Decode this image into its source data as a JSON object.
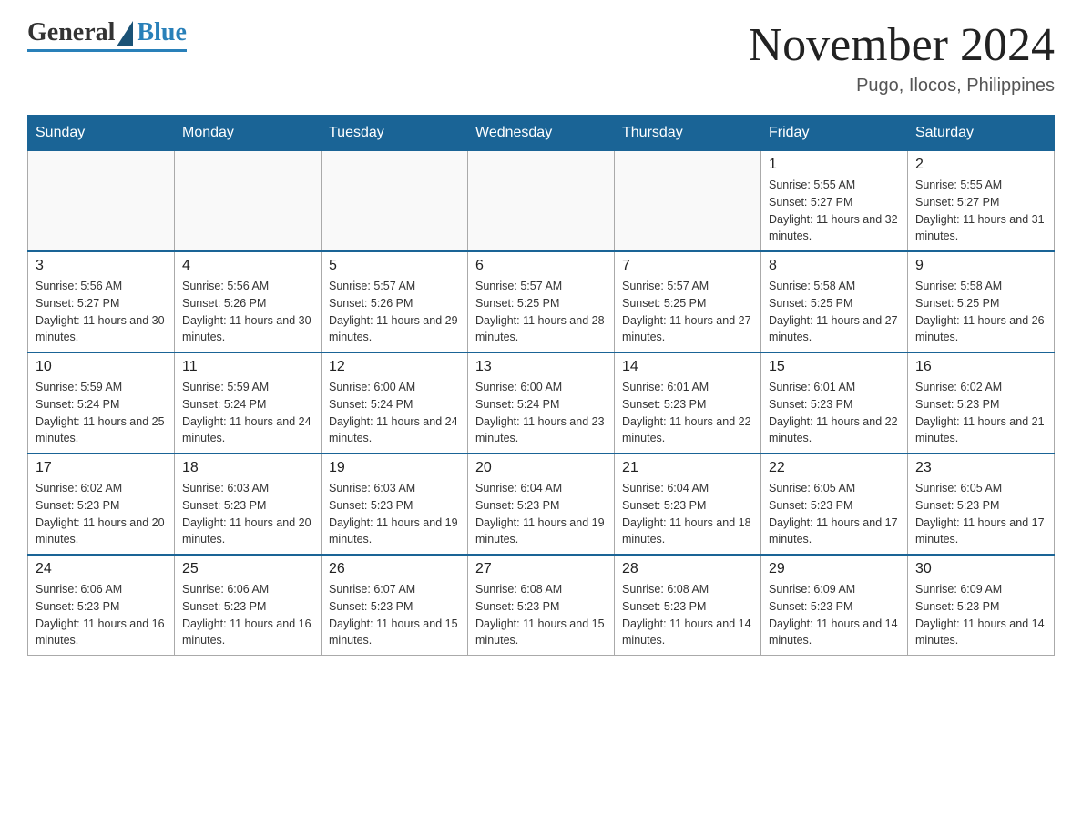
{
  "header": {
    "logo_general": "General",
    "logo_blue": "Blue",
    "month_title": "November 2024",
    "location": "Pugo, Ilocos, Philippines"
  },
  "weekdays": [
    "Sunday",
    "Monday",
    "Tuesday",
    "Wednesday",
    "Thursday",
    "Friday",
    "Saturday"
  ],
  "weeks": [
    [
      {
        "day": "",
        "info": ""
      },
      {
        "day": "",
        "info": ""
      },
      {
        "day": "",
        "info": ""
      },
      {
        "day": "",
        "info": ""
      },
      {
        "day": "",
        "info": ""
      },
      {
        "day": "1",
        "info": "Sunrise: 5:55 AM\nSunset: 5:27 PM\nDaylight: 11 hours and 32 minutes."
      },
      {
        "day": "2",
        "info": "Sunrise: 5:55 AM\nSunset: 5:27 PM\nDaylight: 11 hours and 31 minutes."
      }
    ],
    [
      {
        "day": "3",
        "info": "Sunrise: 5:56 AM\nSunset: 5:27 PM\nDaylight: 11 hours and 30 minutes."
      },
      {
        "day": "4",
        "info": "Sunrise: 5:56 AM\nSunset: 5:26 PM\nDaylight: 11 hours and 30 minutes."
      },
      {
        "day": "5",
        "info": "Sunrise: 5:57 AM\nSunset: 5:26 PM\nDaylight: 11 hours and 29 minutes."
      },
      {
        "day": "6",
        "info": "Sunrise: 5:57 AM\nSunset: 5:25 PM\nDaylight: 11 hours and 28 minutes."
      },
      {
        "day": "7",
        "info": "Sunrise: 5:57 AM\nSunset: 5:25 PM\nDaylight: 11 hours and 27 minutes."
      },
      {
        "day": "8",
        "info": "Sunrise: 5:58 AM\nSunset: 5:25 PM\nDaylight: 11 hours and 27 minutes."
      },
      {
        "day": "9",
        "info": "Sunrise: 5:58 AM\nSunset: 5:25 PM\nDaylight: 11 hours and 26 minutes."
      }
    ],
    [
      {
        "day": "10",
        "info": "Sunrise: 5:59 AM\nSunset: 5:24 PM\nDaylight: 11 hours and 25 minutes."
      },
      {
        "day": "11",
        "info": "Sunrise: 5:59 AM\nSunset: 5:24 PM\nDaylight: 11 hours and 24 minutes."
      },
      {
        "day": "12",
        "info": "Sunrise: 6:00 AM\nSunset: 5:24 PM\nDaylight: 11 hours and 24 minutes."
      },
      {
        "day": "13",
        "info": "Sunrise: 6:00 AM\nSunset: 5:24 PM\nDaylight: 11 hours and 23 minutes."
      },
      {
        "day": "14",
        "info": "Sunrise: 6:01 AM\nSunset: 5:23 PM\nDaylight: 11 hours and 22 minutes."
      },
      {
        "day": "15",
        "info": "Sunrise: 6:01 AM\nSunset: 5:23 PM\nDaylight: 11 hours and 22 minutes."
      },
      {
        "day": "16",
        "info": "Sunrise: 6:02 AM\nSunset: 5:23 PM\nDaylight: 11 hours and 21 minutes."
      }
    ],
    [
      {
        "day": "17",
        "info": "Sunrise: 6:02 AM\nSunset: 5:23 PM\nDaylight: 11 hours and 20 minutes."
      },
      {
        "day": "18",
        "info": "Sunrise: 6:03 AM\nSunset: 5:23 PM\nDaylight: 11 hours and 20 minutes."
      },
      {
        "day": "19",
        "info": "Sunrise: 6:03 AM\nSunset: 5:23 PM\nDaylight: 11 hours and 19 minutes."
      },
      {
        "day": "20",
        "info": "Sunrise: 6:04 AM\nSunset: 5:23 PM\nDaylight: 11 hours and 19 minutes."
      },
      {
        "day": "21",
        "info": "Sunrise: 6:04 AM\nSunset: 5:23 PM\nDaylight: 11 hours and 18 minutes."
      },
      {
        "day": "22",
        "info": "Sunrise: 6:05 AM\nSunset: 5:23 PM\nDaylight: 11 hours and 17 minutes."
      },
      {
        "day": "23",
        "info": "Sunrise: 6:05 AM\nSunset: 5:23 PM\nDaylight: 11 hours and 17 minutes."
      }
    ],
    [
      {
        "day": "24",
        "info": "Sunrise: 6:06 AM\nSunset: 5:23 PM\nDaylight: 11 hours and 16 minutes."
      },
      {
        "day": "25",
        "info": "Sunrise: 6:06 AM\nSunset: 5:23 PM\nDaylight: 11 hours and 16 minutes."
      },
      {
        "day": "26",
        "info": "Sunrise: 6:07 AM\nSunset: 5:23 PM\nDaylight: 11 hours and 15 minutes."
      },
      {
        "day": "27",
        "info": "Sunrise: 6:08 AM\nSunset: 5:23 PM\nDaylight: 11 hours and 15 minutes."
      },
      {
        "day": "28",
        "info": "Sunrise: 6:08 AM\nSunset: 5:23 PM\nDaylight: 11 hours and 14 minutes."
      },
      {
        "day": "29",
        "info": "Sunrise: 6:09 AM\nSunset: 5:23 PM\nDaylight: 11 hours and 14 minutes."
      },
      {
        "day": "30",
        "info": "Sunrise: 6:09 AM\nSunset: 5:23 PM\nDaylight: 11 hours and 14 minutes."
      }
    ]
  ]
}
